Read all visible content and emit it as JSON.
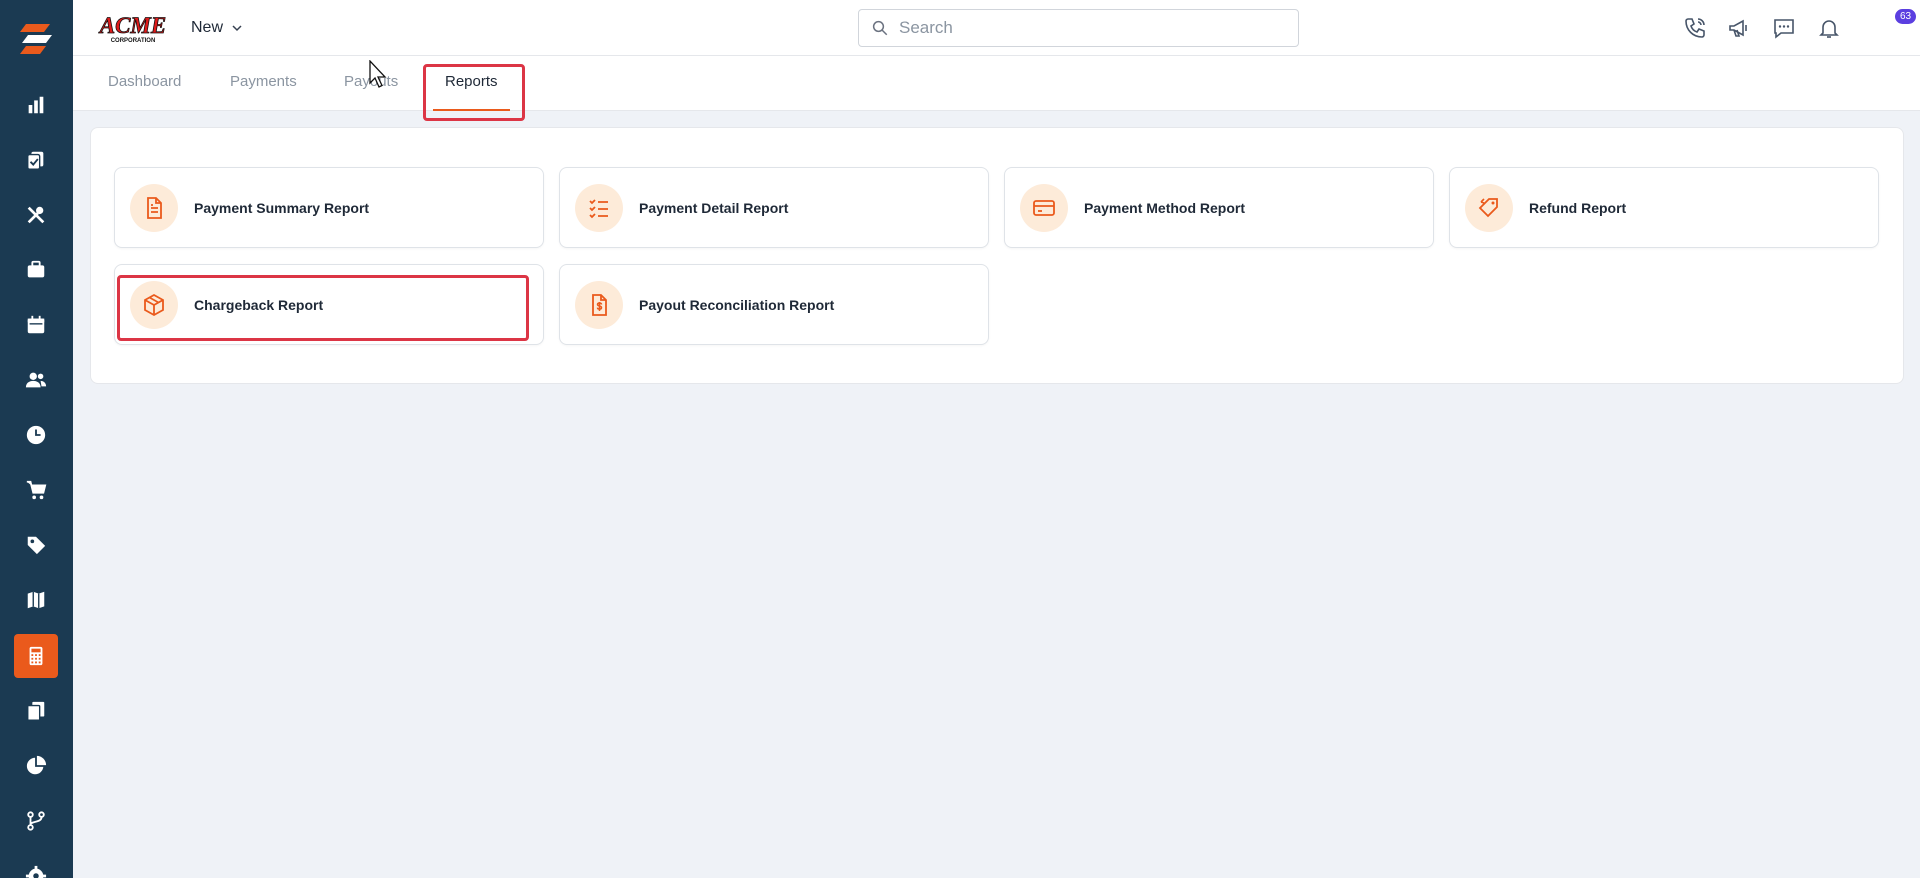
{
  "app": {
    "brand": "ACME CORPORATION",
    "new_label": "New"
  },
  "search": {
    "placeholder": "Search",
    "value": ""
  },
  "notifications": {
    "count": "63"
  },
  "sidebar": {
    "items": [
      {
        "icon": "bar-chart-icon"
      },
      {
        "icon": "clipboard-check-icon"
      },
      {
        "icon": "tools-icon"
      },
      {
        "icon": "briefcase-icon"
      },
      {
        "icon": "calendar-icon"
      },
      {
        "icon": "users-icon"
      },
      {
        "icon": "clock-icon"
      },
      {
        "icon": "cart-icon"
      },
      {
        "icon": "tag-icon"
      },
      {
        "icon": "map-icon"
      },
      {
        "icon": "calculator-icon",
        "active": true
      },
      {
        "icon": "documents-icon"
      },
      {
        "icon": "pie-chart-icon"
      },
      {
        "icon": "workflow-icon"
      },
      {
        "icon": "gear-icon"
      }
    ]
  },
  "tabs": [
    {
      "label": "Dashboard"
    },
    {
      "label": "Payments"
    },
    {
      "label": "Payouts"
    },
    {
      "label": "Reports",
      "active": true
    }
  ],
  "reports": [
    {
      "label": "Payment Summary Report",
      "icon": "document-icon"
    },
    {
      "label": "Payment Detail Report",
      "icon": "checklist-icon"
    },
    {
      "label": "Payment Method Report",
      "icon": "credit-card-icon"
    },
    {
      "label": "Refund Report",
      "icon": "tag-refund-icon"
    },
    {
      "label": "Chargeback Report",
      "icon": "box-icon"
    },
    {
      "label": "Payout Reconciliation Report",
      "icon": "dollar-file-icon"
    }
  ],
  "colors": {
    "sidebar_bg": "#1b3a52",
    "accent": "#ea5a1c",
    "icon_circle": "#fdebd9",
    "highlight": "#dc3545",
    "badge": "#5b3fe0"
  }
}
